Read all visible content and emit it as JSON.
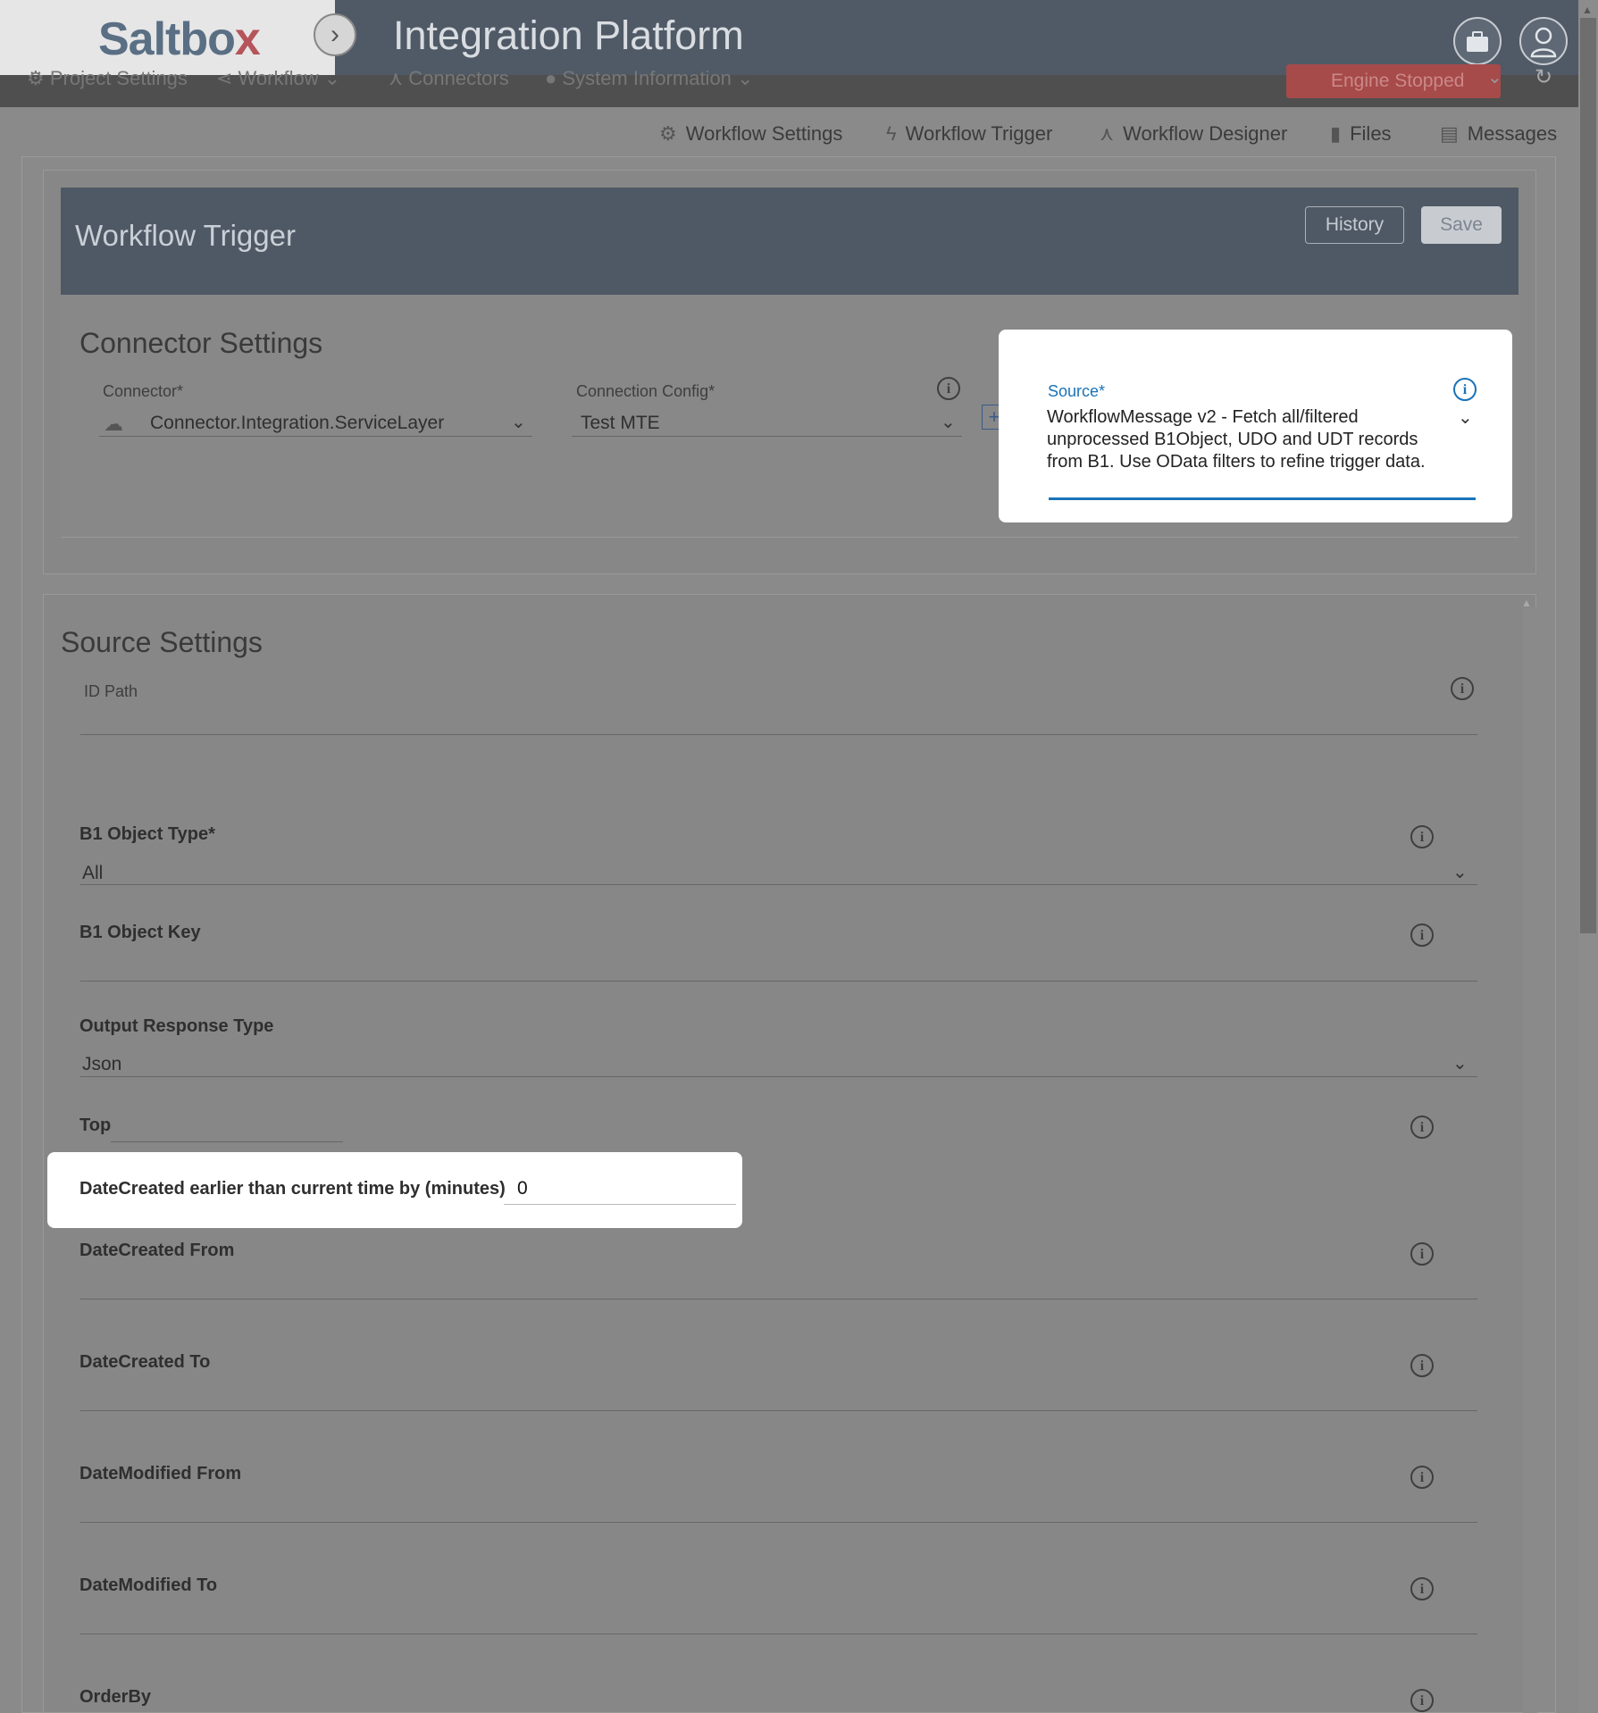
{
  "app": {
    "logo": "Saltbox",
    "title": "Integration Platform",
    "expand_icon": "chevron-right-icon"
  },
  "top_actions": [
    {
      "name": "briefcase-button",
      "icon": "briefcase-icon"
    },
    {
      "name": "user-button",
      "icon": "user-icon"
    }
  ],
  "nav": {
    "project_settings": "Project Settings",
    "workflow": "Workflow",
    "connectors": "Connectors",
    "system_information": "System Information",
    "engine_status": "Engine Stopped",
    "engine_color": "#a64a4a"
  },
  "tabs": [
    {
      "label": "Workflow Settings",
      "icon": "gear-icon"
    },
    {
      "label": "Workflow Trigger",
      "icon": "lightning-icon"
    },
    {
      "label": "Workflow Designer",
      "icon": "sitemap-icon"
    },
    {
      "label": "Files",
      "icon": "file-icon"
    },
    {
      "label": "Messages",
      "icon": "message-icon"
    }
  ],
  "header": {
    "title": "Workflow Trigger",
    "history_label": "History",
    "save_label": "Save"
  },
  "connector_settings": {
    "title": "Connector Settings",
    "connector_label": "Connector*",
    "connector_value": "Connector.Integration.ServiceLayer",
    "connection_config_label": "Connection Config*",
    "connection_config_value": "Test MTE",
    "add_label": "+",
    "source_label": "Source*",
    "source_value": "WorkflowMessage v2 - Fetch all/filtered unprocessed B1Object, UDO and UDT records from B1. Use OData filters to refine trigger data."
  },
  "source_settings": {
    "title": "Source Settings",
    "id_path_label": "ID Path",
    "b1_object_type_label": "B1 Object Type*",
    "b1_object_type_value": "All",
    "b1_object_key_label": "B1 Object Key",
    "output_response_type_label": "Output Response Type",
    "output_response_type_value": "Json",
    "top_label": "Top",
    "datecreated_earlier_label": "DateCreated earlier than current time by (minutes)",
    "datecreated_earlier_value": "0",
    "datecreated_from_label": "DateCreated From",
    "datecreated_to_label": "DateCreated To",
    "datemodified_from_label": "DateModified From",
    "datemodified_to_label": "DateModified To",
    "orderby_label": "OrderBy"
  },
  "colors": {
    "header_bg": "#4f5965",
    "accent": "#1a73b8"
  }
}
